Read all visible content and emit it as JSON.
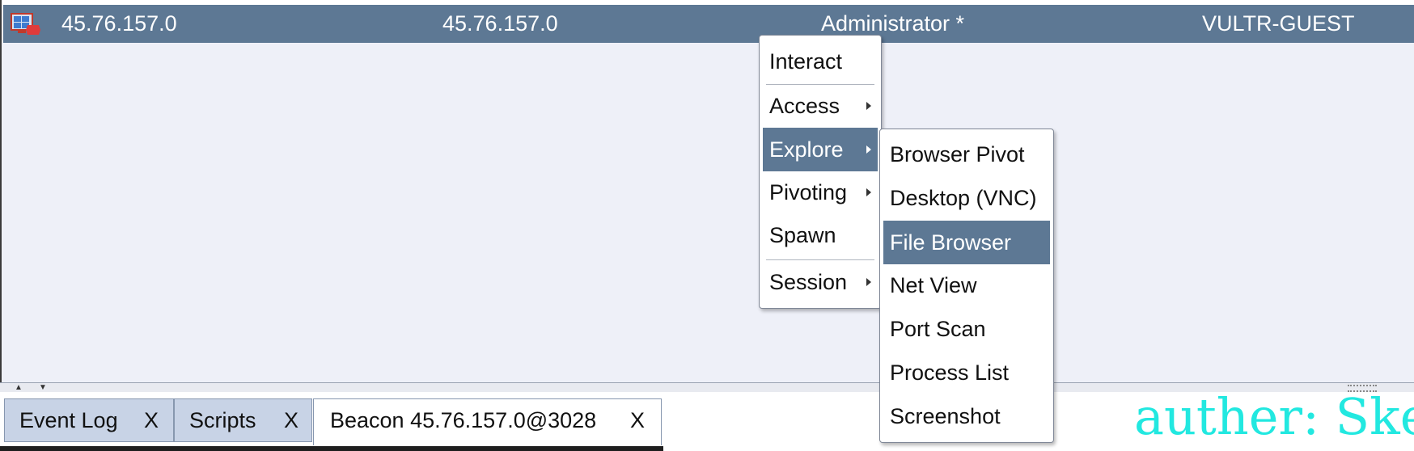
{
  "session_row": {
    "external_ip": "45.76.157.0",
    "internal_ip": "45.76.157.0",
    "user": "Administrator *",
    "computer": "VULTR-GUEST",
    "icon": "windows-host-icon"
  },
  "context_menu": {
    "items": [
      {
        "label": "Interact"
      },
      {
        "label": "Access"
      },
      {
        "label": "Explore"
      },
      {
        "label": "Pivoting"
      },
      {
        "label": "Spawn"
      },
      {
        "label": "Session"
      }
    ]
  },
  "explore_submenu": {
    "items": [
      {
        "label": "Browser Pivot"
      },
      {
        "label": "Desktop (VNC)"
      },
      {
        "label": "File Browser"
      },
      {
        "label": "Net View"
      },
      {
        "label": "Port Scan"
      },
      {
        "label": "Process List"
      },
      {
        "label": "Screenshot"
      }
    ]
  },
  "tabs": [
    {
      "label": "Event Log",
      "close": "X"
    },
    {
      "label": "Scripts",
      "close": "X"
    },
    {
      "label": "Beacon 45.76.157.0@3028",
      "close": "X"
    }
  ],
  "watermark": "auther: Ske",
  "colors": {
    "row_highlight": "#5d7894",
    "tab_inactive": "#c8d3e6",
    "watermark": "#22e8e0"
  }
}
